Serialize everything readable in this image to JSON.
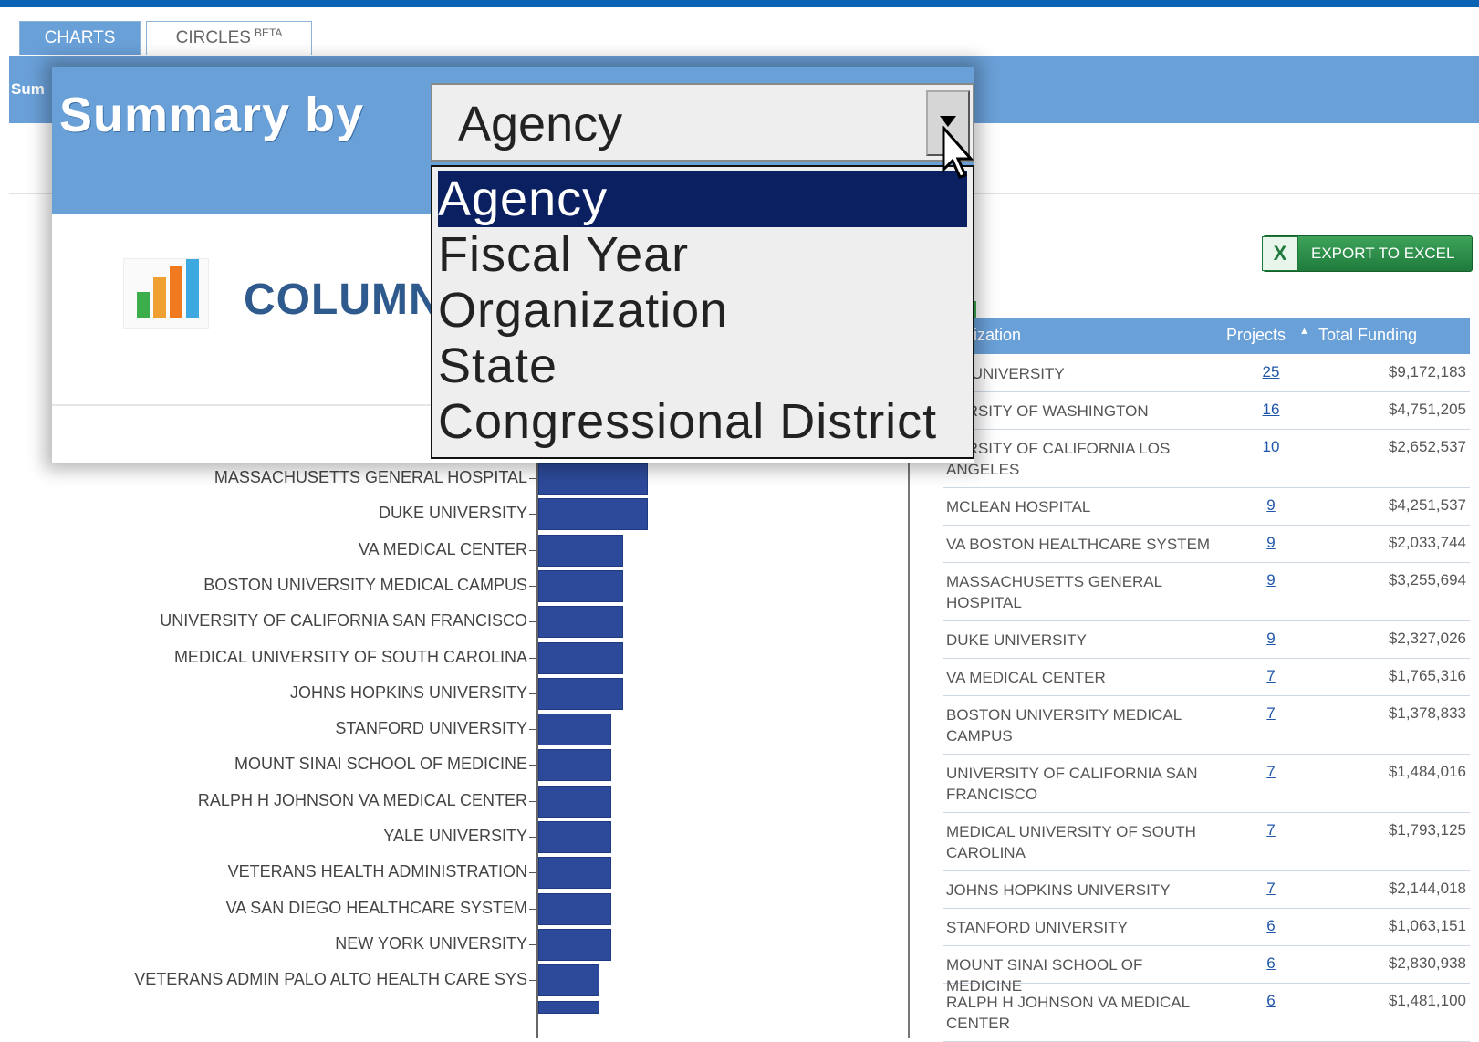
{
  "tabs": [
    {
      "label": "CHARTS"
    },
    {
      "label": "CIRCLES",
      "badge": "BETA"
    }
  ],
  "header": {
    "partial_label": "Sum"
  },
  "popup": {
    "title": "Summary by",
    "chart_type_label": "COLUMN",
    "select": {
      "value": "Agency",
      "options": [
        "Agency",
        "Fiscal Year",
        "Organization",
        "State",
        "Congressional District"
      ],
      "selected_index": 0
    }
  },
  "export": {
    "label": "EXPORT TO EXCEL",
    "icon": "excel-icon"
  },
  "table": {
    "columns": {
      "organization": "anization",
      "projects": "Projects",
      "funding": "Total Funding"
    },
    "sort": {
      "column": "Projects",
      "direction": "asc"
    },
    "rows": [
      {
        "org": "RY UNIVERSITY",
        "projects": "25",
        "funding": "$9,172,183"
      },
      {
        "org": "VERSITY OF WASHINGTON",
        "projects": "16",
        "funding": "$4,751,205"
      },
      {
        "org": "VERSITY OF CALIFORNIA LOS ANGELES",
        "projects": "10",
        "funding": "$2,652,537"
      },
      {
        "org": "MCLEAN HOSPITAL",
        "projects": "9",
        "funding": "$4,251,537"
      },
      {
        "org": "VA BOSTON HEALTHCARE SYSTEM",
        "projects": "9",
        "funding": "$2,033,744"
      },
      {
        "org": "MASSACHUSETTS GENERAL HOSPITAL",
        "projects": "9",
        "funding": "$3,255,694"
      },
      {
        "org": "DUKE UNIVERSITY",
        "projects": "9",
        "funding": "$2,327,026"
      },
      {
        "org": "VA MEDICAL CENTER",
        "projects": "7",
        "funding": "$1,765,316"
      },
      {
        "org": "BOSTON UNIVERSITY MEDICAL CAMPUS",
        "projects": "7",
        "funding": "$1,378,833"
      },
      {
        "org": "UNIVERSITY OF CALIFORNIA SAN FRANCISCO",
        "projects": "7",
        "funding": "$1,484,016"
      },
      {
        "org": "MEDICAL UNIVERSITY OF SOUTH CAROLINA",
        "projects": "7",
        "funding": "$1,793,125"
      },
      {
        "org": "JOHNS HOPKINS UNIVERSITY",
        "projects": "7",
        "funding": "$2,144,018"
      },
      {
        "org": "STANFORD UNIVERSITY",
        "projects": "6",
        "funding": "$1,063,151"
      },
      {
        "org": "MOUNT SINAI SCHOOL OF MEDICINE",
        "projects": "6",
        "funding": "$2,830,938"
      },
      {
        "org": "RALPH H JOHNSON VA MEDICAL CENTER",
        "projects": "6",
        "funding": "$1,481,100"
      }
    ]
  },
  "chart_data": {
    "type": "bar",
    "orientation": "horizontal",
    "categories": [
      "MASSACHUSETTS GENERAL HOSPITAL",
      "DUKE UNIVERSITY",
      "VA MEDICAL CENTER",
      "BOSTON UNIVERSITY MEDICAL CAMPUS",
      "UNIVERSITY OF CALIFORNIA SAN FRANCISCO",
      "MEDICAL UNIVERSITY OF SOUTH CAROLINA",
      "JOHNS HOPKINS UNIVERSITY",
      "STANFORD UNIVERSITY",
      "MOUNT SINAI SCHOOL OF MEDICINE",
      "RALPH H JOHNSON VA MEDICAL CENTER",
      "YALE UNIVERSITY",
      "VETERANS HEALTH ADMINISTRATION",
      "VA SAN DIEGO HEALTHCARE SYSTEM",
      "NEW YORK UNIVERSITY",
      "VETERANS ADMIN PALO ALTO HEALTH CARE SYS"
    ],
    "values": [
      9,
      9,
      7,
      7,
      7,
      7,
      7,
      6,
      6,
      6,
      6,
      6,
      6,
      6,
      5
    ],
    "color": "#2d4a9a"
  },
  "colors": {
    "accent": "#6aa0d8",
    "top_bar": "#0a64b4",
    "selection": "#0b2060",
    "link": "#1f56a8",
    "excel_green": "#1e7b3c"
  }
}
